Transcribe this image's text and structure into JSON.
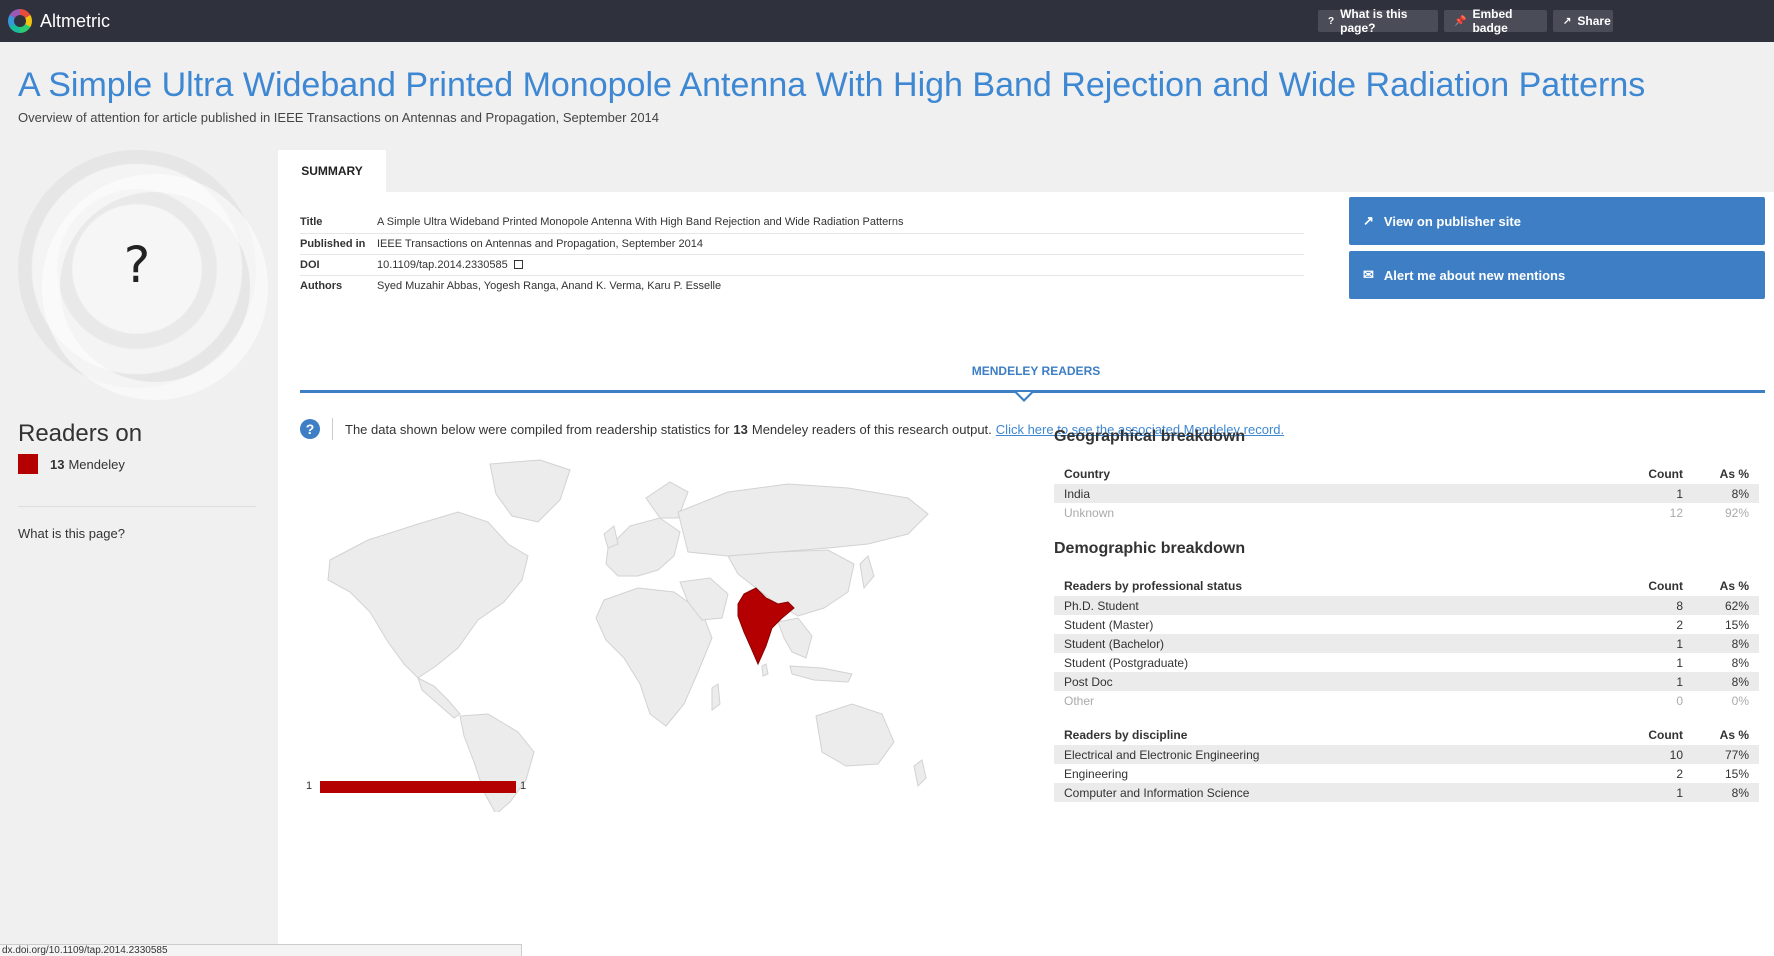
{
  "topbar": {
    "brand": "Altmetric",
    "what_btn": "What is this page?",
    "embed_btn": "Embed badge",
    "share_btn": "Share"
  },
  "header": {
    "title": "A Simple Ultra Wideband Printed Monopole Antenna With High Band Rejection and Wide Radiation Patterns",
    "subtitle": "Overview of attention for article published in IEEE Transactions on Antennas and Propagation, September 2014"
  },
  "sidebar": {
    "score": "?",
    "readers_heading": "Readers on",
    "readers_count": "13",
    "readers_source": "Mendeley",
    "help_link": "What is this page?",
    "readers_color": "#b40000"
  },
  "tabs": {
    "summary": "SUMMARY"
  },
  "meta": {
    "title_label": "Title",
    "title_value": "A Simple Ultra Wideband Printed Monopole Antenna With High Band Rejection and Wide Radiation Patterns",
    "published_label": "Published in",
    "published_value": "IEEE Transactions on Antennas and Propagation, September 2014",
    "doi_label": "DOI",
    "doi_value": "10.1109/tap.2014.2330585",
    "authors_label": "Authors",
    "authors_value": "Syed Muzahir Abbas, Yogesh Ranga, Anand K. Verma, Karu P. Esselle"
  },
  "actions": {
    "publisher": "View on publisher site",
    "alert": "Alert me about new mentions"
  },
  "mendeley": {
    "section_label": "MENDELEY READERS",
    "info_pre": "The data shown below were compiled from readership statistics for",
    "info_count": "13",
    "info_post": "Mendeley readers of this research output.",
    "info_link": "Click here to see the associated Mendeley record.",
    "legend_min": "1",
    "legend_max": "1",
    "highlight_country": "India",
    "highlight_color": "#b40000"
  },
  "geo": {
    "title": "Geographical breakdown",
    "headers": [
      "Country",
      "Count",
      "As %"
    ],
    "rows": [
      [
        "India",
        "1",
        "8%"
      ],
      [
        "Unknown",
        "12",
        "92%"
      ]
    ]
  },
  "demo": {
    "title": "Demographic breakdown",
    "status_headers": [
      "Readers by professional status",
      "Count",
      "As %"
    ],
    "status_rows": [
      [
        "Ph.D. Student",
        "8",
        "62%"
      ],
      [
        "Student (Master)",
        "2",
        "15%"
      ],
      [
        "Student (Bachelor)",
        "1",
        "8%"
      ],
      [
        "Student (Postgraduate)",
        "1",
        "8%"
      ],
      [
        "Post Doc",
        "1",
        "8%"
      ],
      [
        "Other",
        "0",
        "0%"
      ]
    ],
    "discipline_headers": [
      "Readers by discipline",
      "Count",
      "As %"
    ],
    "discipline_rows": [
      [
        "Electrical and Electronic Engineering",
        "10",
        "77%"
      ],
      [
        "Engineering",
        "2",
        "15%"
      ],
      [
        "Computer and Information Science",
        "1",
        "8%"
      ]
    ]
  },
  "statusbar": {
    "url": "dx.doi.org/10.1109/tap.2014.2330585"
  }
}
